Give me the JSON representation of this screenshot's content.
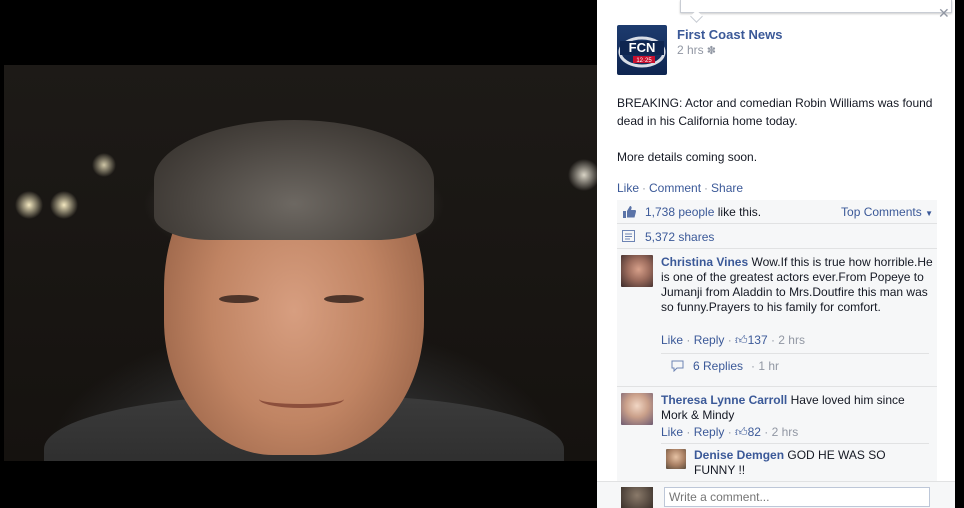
{
  "post": {
    "page_name": "First Coast News",
    "time": "2 hrs",
    "text_line_1": "BREAKING: Actor and comedian Robin Williams was found dead in his California home today.",
    "text_line_2": "More details coming soon."
  },
  "actions": {
    "like": "Like",
    "comment": "Comment",
    "share": "Share",
    "sep": "·"
  },
  "ufi": {
    "likes_count": "1,738 people",
    "likes_suffix": " like this.",
    "top_comments": "Top Comments",
    "shares": "5,372 shares"
  },
  "comments": [
    {
      "name": "Christina Vines",
      "text": "Wow.If this is true how horrible.He is one of the greatest actors ever.From Popeye to Jumanji from Aladdin to Mrs.Doutfire this man was so funny.Prayers to his family for comfort.",
      "like": "Like",
      "reply": "Reply",
      "likes": "137",
      "time": "2 hrs",
      "replies_label": "6 Replies",
      "replies_time": "1 hr"
    },
    {
      "name": "Theresa Lynne Carroll",
      "text": "Have loved him since Mork & Mindy",
      "like": "Like",
      "reply": "Reply",
      "likes": "82",
      "time": "2 hrs",
      "reply_preview": {
        "name": "Denise Demgen",
        "text": "GOD HE WAS SO FUNNY !!"
      }
    }
  ],
  "composer": {
    "placeholder": "Write a comment..."
  },
  "logo": {
    "text": "FCN",
    "subtext": "12·25"
  },
  "icons": {
    "close": "close-icon",
    "gear": "gear-icon",
    "like": "thumbs-up-icon",
    "share": "share-icon",
    "replies": "speech-bubble-icon"
  },
  "colors": {
    "link": "#3b5998",
    "meta": "#9197a3",
    "ufi_bg": "#f6f7f8"
  }
}
